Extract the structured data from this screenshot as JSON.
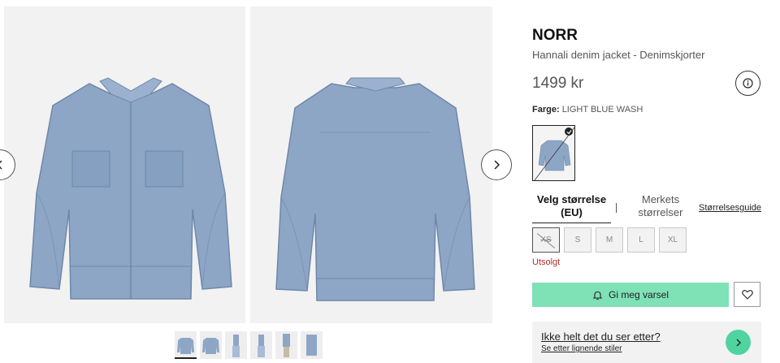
{
  "product": {
    "brand": "NORR",
    "name": "Hannali denim jacket - Denimskjorter",
    "price": "1499 kr",
    "color_label": "Farge:",
    "color_value": "LIGHT BLUE WASH"
  },
  "sizes": {
    "tab_eu": "Velg størrelse (EU)",
    "tab_brand": "Merkets størrelser",
    "guide": "Størrelsesguide",
    "options": [
      "XS",
      "S",
      "M",
      "L",
      "XL"
    ],
    "status": "Utsolgt"
  },
  "actions": {
    "notify_label": "Gi meg varsel"
  },
  "suggest": {
    "title": "Ikke helt det du ser etter?",
    "link": "Se etter lignende stiler"
  },
  "colors": {
    "denim": "#8ea6c6",
    "denim_dark": "#7a93b5",
    "accent_green": "#7fe1b6",
    "accent_green_dark": "#4fd4a0",
    "soldout_red": "#b03030"
  },
  "icons": [
    "chevron-left-icon",
    "chevron-right-icon",
    "info-icon",
    "check-icon",
    "bell-icon",
    "heart-icon"
  ]
}
